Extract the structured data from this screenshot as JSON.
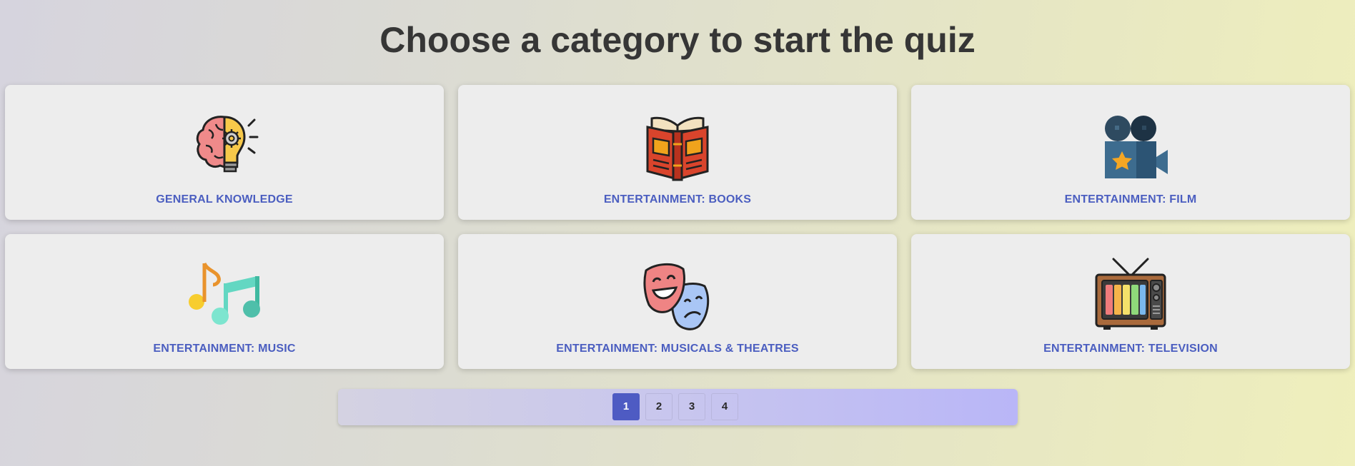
{
  "page": {
    "title": "Choose a category to start the quiz"
  },
  "categories": [
    {
      "label": "GENERAL KNOWLEDGE",
      "icon": "brain-lightbulb-icon"
    },
    {
      "label": "ENTERTAINMENT: BOOKS",
      "icon": "open-book-icon"
    },
    {
      "label": "ENTERTAINMENT: FILM",
      "icon": "movie-camera-icon"
    },
    {
      "label": "ENTERTAINMENT: MUSIC",
      "icon": "music-notes-icon"
    },
    {
      "label": "ENTERTAINMENT: MUSICALS & THEATRES",
      "icon": "theatre-masks-icon"
    },
    {
      "label": "ENTERTAINMENT: TELEVISION",
      "icon": "retro-tv-icon"
    }
  ],
  "pagination": {
    "pages": [
      "1",
      "2",
      "3",
      "4"
    ],
    "current": "1"
  },
  "colors": {
    "label_text": "#4b5ec0",
    "active_page": "#4e5bc3",
    "card_background": "#ededed",
    "title_text": "#363636"
  }
}
